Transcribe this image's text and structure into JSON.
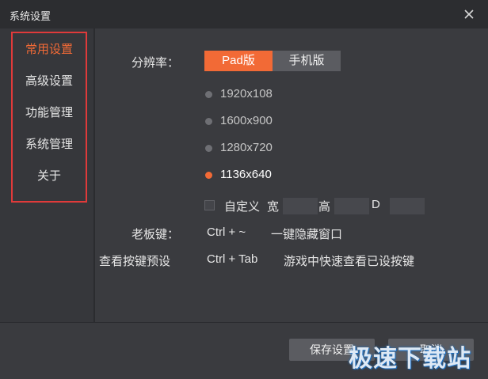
{
  "window": {
    "title": "系统设置"
  },
  "sidebar": {
    "items": [
      {
        "label": "常用设置",
        "active": true
      },
      {
        "label": "高级设置",
        "active": false
      },
      {
        "label": "功能管理",
        "active": false
      },
      {
        "label": "系统管理",
        "active": false
      },
      {
        "label": "关于",
        "active": false
      }
    ]
  },
  "resolution": {
    "label": "分辨率：",
    "tabs": [
      {
        "label": "Pad版",
        "active": true
      },
      {
        "label": "手机版",
        "active": false
      }
    ],
    "options": [
      {
        "label": "1920x108",
        "selected": false
      },
      {
        "label": "1600x900",
        "selected": false
      },
      {
        "label": "1280x720",
        "selected": false
      },
      {
        "label": "1136x640",
        "selected": true
      }
    ],
    "custom": {
      "label": "自定义",
      "width_label": "宽",
      "width_value": "",
      "height_label": "高",
      "height_value": "",
      "d_label": "D",
      "d_value": ""
    }
  },
  "boss_key": {
    "label": "老板键：",
    "shortcut": "Ctrl + ~",
    "description": "一键隐藏窗口"
  },
  "view_keys": {
    "label": "查看按键预设",
    "shortcut": "Ctrl + Tab",
    "description": "游戏中快速查看已设按键"
  },
  "footer": {
    "save_label": "保存设置",
    "cancel_label": "取消"
  },
  "watermark": {
    "text": "极速下载站"
  },
  "colors": {
    "accent": "#f26a36",
    "highlight_border": "#e03a3a",
    "background": "#3a3b3f",
    "titlebar": "#2c2d30"
  },
  "icons": {
    "close": "close-icon"
  }
}
